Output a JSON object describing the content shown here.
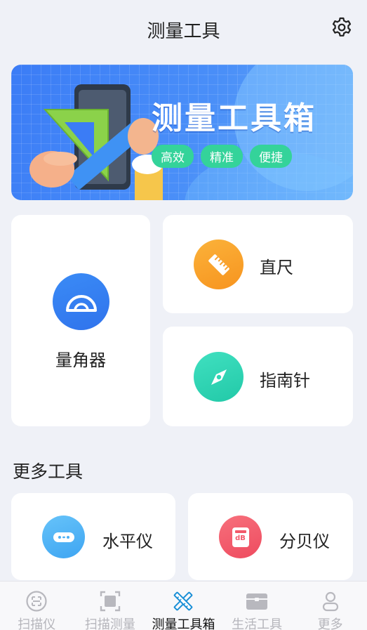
{
  "header": {
    "title": "测量工具"
  },
  "banner": {
    "headline": "测量工具箱",
    "tags": [
      "高效",
      "精准",
      "便捷"
    ]
  },
  "tools": {
    "protractor": "量角器",
    "ruler": "直尺",
    "compass": "指南针"
  },
  "more": {
    "title": "更多工具",
    "level": "水平仪",
    "decibel": "分贝仪",
    "decibel_icon_text": "dB"
  },
  "tabs": [
    {
      "label": "扫描仪",
      "icon": "scan-face-icon"
    },
    {
      "label": "扫描测量",
      "icon": "scan-square-icon"
    },
    {
      "label": "测量工具箱",
      "icon": "crossed-rulers-icon",
      "active": true
    },
    {
      "label": "生活工具",
      "icon": "toolbox-icon"
    },
    {
      "label": "更多",
      "icon": "person-icon"
    }
  ],
  "colors": {
    "background": "#eff1f7",
    "banner_blue": "#3b7cf6",
    "tag_green": "#34d39a",
    "protractor_blue": "#3d7ff2",
    "ruler_orange": "#f9a22c",
    "compass_teal": "#2fd6b5",
    "level_blue": "#4cb0f5",
    "decibel_red": "#f2596a"
  }
}
